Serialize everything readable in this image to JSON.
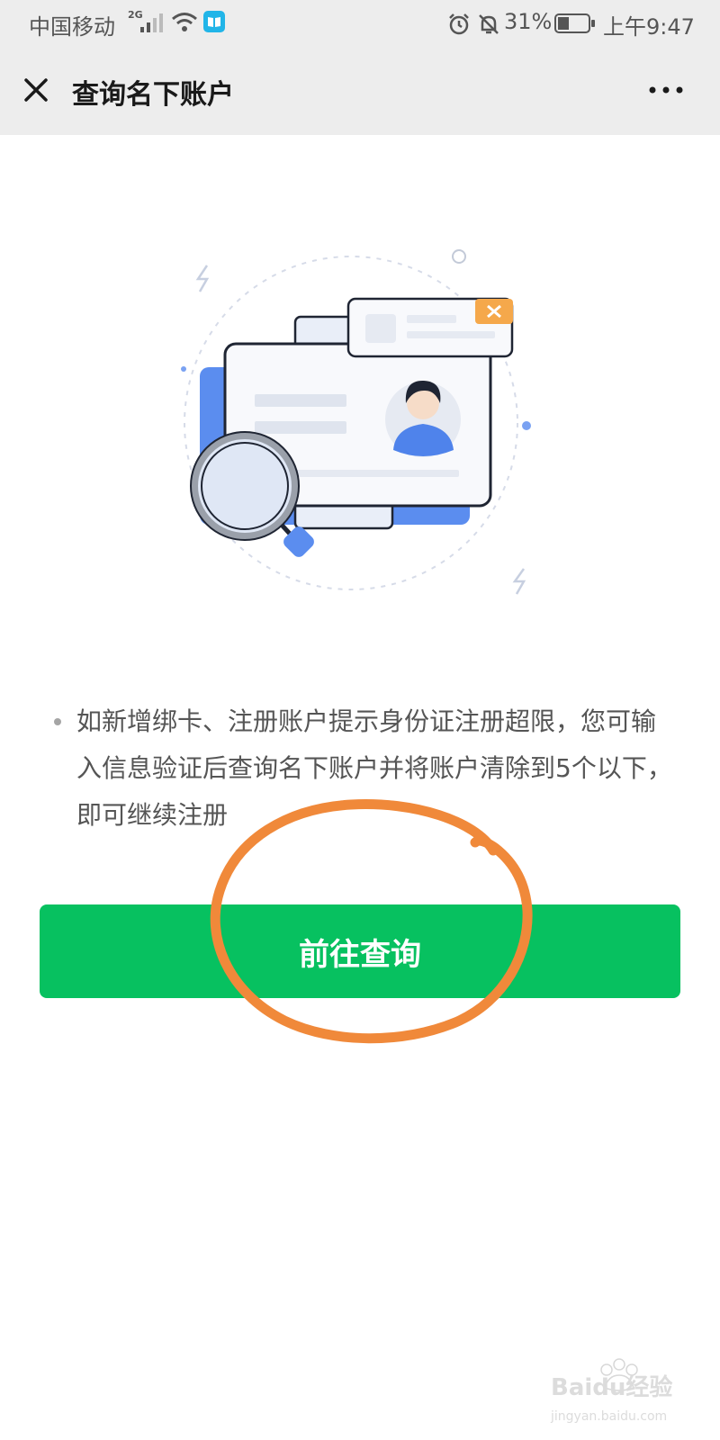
{
  "status_bar": {
    "carrier": "中国移动",
    "network_type": "2G",
    "battery_percent": "31%",
    "time": "上午9:47",
    "icons": [
      "signal-icon",
      "wifi-icon",
      "reader-app-icon",
      "alarm-icon",
      "mute-bell-icon",
      "battery-icon"
    ]
  },
  "nav": {
    "title": "查询名下账户",
    "close_icon": "close-icon",
    "more_icon": "more-icon"
  },
  "main": {
    "illustration": "id-card-search-illustration",
    "notice": "如新增绑卡、注册账户提示身份证注册超限，您可输入信息验证后查询名下账户并将账户清除到5个以下，即可继续注册",
    "button_label": "前往查询"
  },
  "watermark": {
    "brand": "Baidu经验",
    "url": "jingyan.baidu.com"
  },
  "colors": {
    "primary_green": "#07c160",
    "annotation_orange": "#f0893a",
    "illustration_blue": "#5b8def",
    "badge_orange": "#f5a84b"
  }
}
